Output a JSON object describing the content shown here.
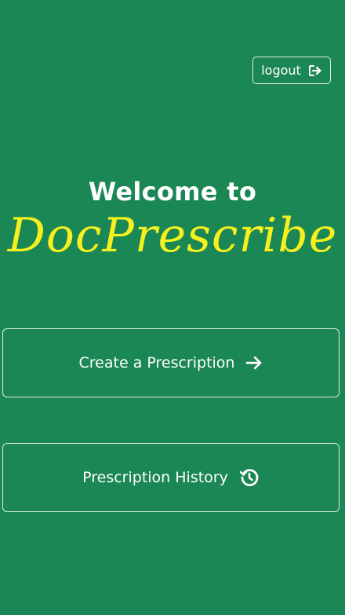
{
  "header": {
    "logout_label": "logout",
    "logout_icon": "sign-out-icon"
  },
  "hero": {
    "welcome_text": "Welcome to",
    "brand_name": "DocPrescribe",
    "brand_color": "#f5f01e"
  },
  "actions": {
    "create_label": "Create a Prescription",
    "create_icon": "arrow-right-icon",
    "history_label": "Prescription History",
    "history_icon": "history-icon"
  },
  "theme": {
    "background": "#1b8755",
    "text": "#ffffff"
  }
}
